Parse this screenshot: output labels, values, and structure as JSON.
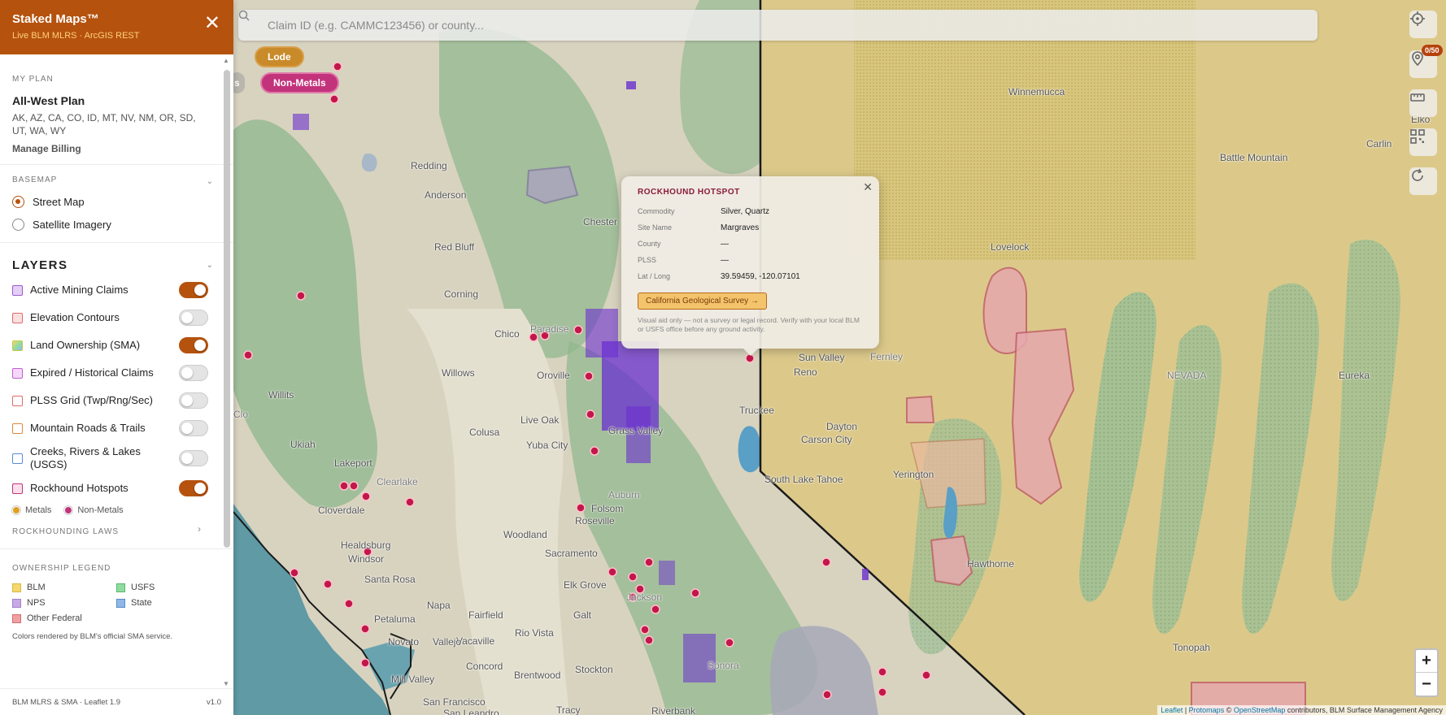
{
  "app": {
    "title": "Staked Maps™",
    "subtitle": "Live BLM MLRS · ArcGIS REST",
    "close_label": "✕"
  },
  "search": {
    "placeholder": "Claim ID (e.g. CAMMC123456) or county..."
  },
  "filter_chips": {
    "lode": "Lode",
    "partial": "s",
    "non_metals": "Non-Metals"
  },
  "controls": {
    "badge": "0/50",
    "zoom_in": "+",
    "zoom_out": "−"
  },
  "plan": {
    "section_label": "MY PLAN",
    "name": "All-West Plan",
    "states": "AK, AZ, CA, CO, ID, MT, NV, NM, OR, SD, UT, WA, WY",
    "billing_link": "Manage Billing"
  },
  "basemap": {
    "section_label": "BASEMAP",
    "options": [
      {
        "label": "Street Map",
        "selected": true
      },
      {
        "label": "Satellite Imagery",
        "selected": false
      }
    ]
  },
  "layers": {
    "heading": "LAYERS",
    "items": [
      {
        "label": "Active Mining Claims",
        "on": true,
        "color": "#9b59d0"
      },
      {
        "label": "Elevation Contours",
        "on": false,
        "color": "#e06a6a"
      },
      {
        "label": "Land Ownership (SMA)",
        "on": true,
        "color": "#c8c840"
      },
      {
        "label": "Expired / Historical Claims",
        "on": false,
        "color": "#c060d0"
      },
      {
        "label": "PLSS Grid (Twp/Rng/Sec)",
        "on": false,
        "color": "#e06a6a"
      },
      {
        "label": "Mountain Roads & Trails",
        "on": false,
        "color": "#e08a3a"
      },
      {
        "label": "Creeks, Rivers & Lakes (USGS)",
        "on": false,
        "color": "#5a8ad8"
      },
      {
        "label": "Rockhound Hotspots",
        "on": true,
        "color": "#c2337c"
      }
    ],
    "mini_legend": [
      {
        "label": "Metals",
        "color": "#e0a020"
      },
      {
        "label": "Non-Metals",
        "color": "#c2337c"
      }
    ],
    "laws_label": "ROCKHOUNDING LAWS"
  },
  "ownership_legend": {
    "section_label": "OWNERSHIP LEGEND",
    "items": [
      {
        "label": "BLM",
        "color": "#f5d76e"
      },
      {
        "label": "USFS",
        "color": "#8fdca0"
      },
      {
        "label": "NPS",
        "color": "#c9a8e8"
      },
      {
        "label": "State",
        "color": "#8fb8e8"
      },
      {
        "label": "Other Federal",
        "color": "#f0a0a0"
      }
    ],
    "note": "Colors rendered by BLM's official SMA service."
  },
  "footer": {
    "left": "BLM MLRS & SMA · Leaflet 1.9",
    "right": "v1.0"
  },
  "popup": {
    "title": "ROCKHOUND HOTSPOT",
    "close": "✕",
    "rows": [
      {
        "key": "Commodity",
        "value": "Silver, Quartz"
      },
      {
        "key": "Site Name",
        "value": "Margraves"
      },
      {
        "key": "County",
        "value": "—"
      },
      {
        "key": "PLSS",
        "value": "—"
      },
      {
        "key": "Lat / Long",
        "value": "39.59459, -120.07101"
      }
    ],
    "button": "California Geological Survey →",
    "disclaimer": "Visual aid only — not a survey or legal record. Verify with your local BLM or USFS office before any ground activity."
  },
  "map_places": [
    "Winnemucca",
    "Elko",
    "Carlin",
    "Battle Mountain",
    "Redding",
    "Anderson",
    "Red Bluff",
    "Chester",
    "Corning",
    "Chico",
    "Paradise",
    "Willows",
    "Oroville",
    "Lovelock",
    "Sun Valley",
    "Reno",
    "Fernley",
    "Eureka",
    "NEVADA",
    "Truckee",
    "Live Oak",
    "Colusa",
    "Yuba City",
    "Grass Valley",
    "Dayton",
    "Carson City",
    "Ukiah",
    "Lakeport",
    "Clearlake",
    "South Lake Tahoe",
    "Yerington",
    "Cloverdale",
    "Auburn",
    "Healdsburg",
    "Windsor",
    "Woodland",
    "Roseville",
    "Folsom",
    "Santa Rosa",
    "Sacramento",
    "Hawthorne",
    "Elk Grove",
    "Napa",
    "Fairfield",
    "Petaluma",
    "Vacaville",
    "Galt",
    "Jackson",
    "Novato",
    "Vallejo",
    "Rio Vista",
    "Tonopah",
    "Concord",
    "Brentwood",
    "Stockton",
    "Sonora",
    "Mill Valley",
    "Tracy",
    "San Francisco",
    "San Leandro",
    "Riverbank",
    "Willits",
    "Ukiah",
    "Clo"
  ],
  "attribution": {
    "leaflet": "Leaflet",
    "sep": " | ",
    "protomaps": "Protomaps",
    "osm_prefix": " © ",
    "osm": "OpenStreetMap",
    "rest": " contributors, BLM Surface Management Agency"
  }
}
